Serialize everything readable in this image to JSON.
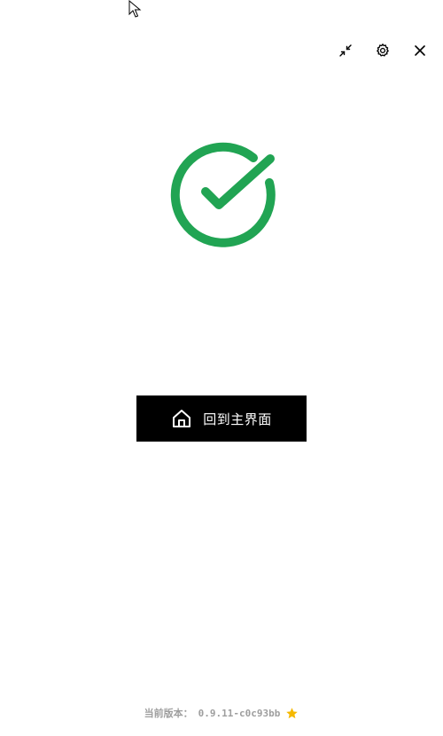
{
  "window": {
    "controls": [
      {
        "name": "minimize",
        "icon": "minimize-arrows-icon"
      },
      {
        "name": "settings",
        "icon": "gear-icon"
      },
      {
        "name": "close",
        "icon": "close-icon"
      }
    ]
  },
  "status": {
    "icon": "check-circle-icon",
    "color": "#21a453"
  },
  "home_button": {
    "icon": "home-icon",
    "label": "回到主界面",
    "background": "#000000"
  },
  "footer": {
    "version_prefix": "当前版本：",
    "version": "0.9.11-c0c93bb",
    "star_icon": "star-icon",
    "star_color": "#f5b800"
  }
}
